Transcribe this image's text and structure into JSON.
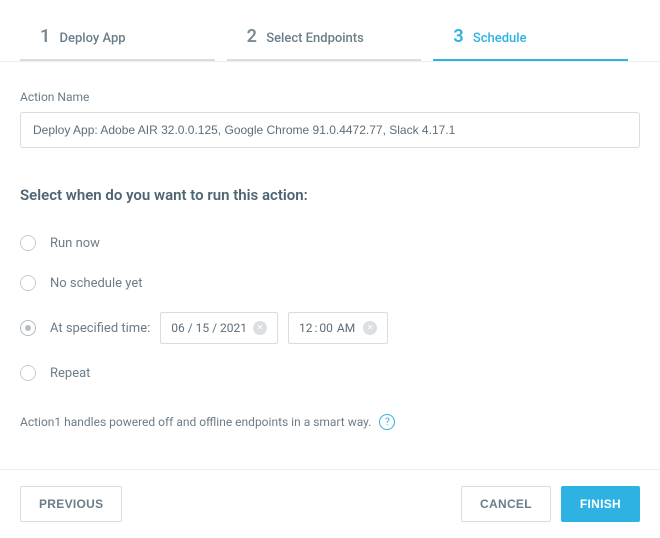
{
  "steps": [
    {
      "num": "1",
      "title": "Deploy App",
      "active": false
    },
    {
      "num": "2",
      "title": "Select Endpoints",
      "active": false
    },
    {
      "num": "3",
      "title": "Schedule",
      "active": true
    }
  ],
  "action_name": {
    "label": "Action Name",
    "value": "Deploy App: Adobe AIR 32.0.0.125, Google Chrome 91.0.4472.77, Slack 4.17.1"
  },
  "schedule": {
    "heading": "Select when do you want to run this action:",
    "options": {
      "run_now": "Run now",
      "no_schedule": "No schedule yet",
      "at_time": "At specified time:",
      "repeat": "Repeat"
    },
    "selected": "at_time",
    "date": "06 / 15 / 2021",
    "time_hh": "12",
    "time_mm": "00",
    "ampm": "AM"
  },
  "note": {
    "text": "Action1 handles powered off and offline endpoints in a smart way.",
    "help_symbol": "?"
  },
  "buttons": {
    "previous": "PREVIOUS",
    "cancel": "CANCEL",
    "finish": "FINISH"
  }
}
